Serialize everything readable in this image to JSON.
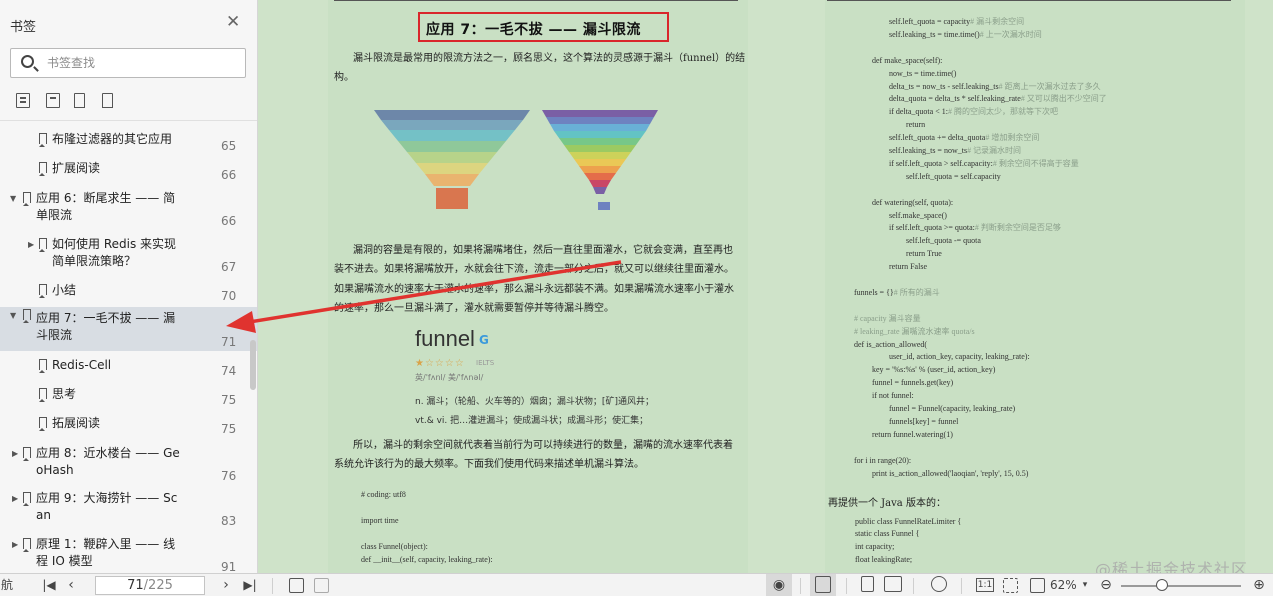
{
  "sidebar": {
    "title": "书签",
    "search_placeholder": "书签查找",
    "bookmarks": [
      {
        "label": "布隆过滤器的其它应用",
        "page": "65",
        "arrow": ""
      },
      {
        "label": "扩展阅读",
        "page": "66",
        "arrow": ""
      },
      {
        "label": "应用 6：断尾求生 —— 简单限流",
        "label1": "应用 6：断尾求生 —— 简",
        "label2": "单限流",
        "page": "66",
        "arrow": "▼"
      },
      {
        "label": "如何使用 Redis 来实现简单限流策略？",
        "label1": "如何使用 Redis 来实现",
        "label2": "简单限流策略？",
        "page": "67",
        "arrow": "▶"
      },
      {
        "label": "小结",
        "page": "70",
        "arrow": ""
      },
      {
        "label": "应用 7：一毛不拔 —— 漏斗限流",
        "label1": "应用 7：一毛不拔 —— 漏",
        "label2": "斗限流",
        "page": "71",
        "arrow": "▼"
      },
      {
        "label": "Redis-Cell",
        "page": "74",
        "arrow": ""
      },
      {
        "label": "思考",
        "page": "75",
        "arrow": ""
      },
      {
        "label": "拓展阅读",
        "page": "75",
        "arrow": ""
      },
      {
        "label": "应用 8：近水楼台 —— GeoHash",
        "label1": "应用 8：近水楼台 —— Ge",
        "label2": "oHash",
        "page": "76",
        "arrow": "▶"
      },
      {
        "label": "应用 9：大海捞针 —— Scan",
        "label1": "应用 9：大海捞针 —— Sc",
        "label2": "an",
        "page": "83",
        "arrow": "▶"
      },
      {
        "label": "原理 1：鞭辟入里 —— 线程 IO 模型",
        "label1": "原理 1：鞭辟入里 —— 线",
        "label2": "程 IO 模型",
        "page": "91",
        "arrow": "▶"
      }
    ]
  },
  "document": {
    "title": "应用 7：一毛不拔 —— 漏斗限流",
    "intro": "漏斗限流是最常用的限流方法之一，顾名思义，这个算法的灵感源于漏斗（funnel）的结构。",
    "intro1": "漏斗限流是最常用的限流方法之一，顾名思义，这个算法的灵感源于漏斗（funnel）的结",
    "intro2": "构。",
    "para2_lines": [
      "漏洞的容量是有限的，如果将漏嘴堵住，然后一直往里面灌水，它就会变满，直至再也",
      "装不进去。如果将漏嘴放开，水就会往下流，流走一部分之后，就又可以继续往里面灌水。",
      "如果漏嘴流水的速率大于灌水的速率，那么漏斗永远都装不满。如果漏嘴流水速率小于灌水",
      "的速率，那么一旦漏斗满了，灌水就需要暂停并等待漏斗腾空。"
    ],
    "dict": {
      "word": "funnel",
      "level": "IELTS",
      "phonetic": "英/'fʌnl/  美/'fʌnəl/",
      "def1": "n. 漏斗；（轮船、火车等的）烟囱；漏斗状物；[矿]通风井；",
      "def2": "vt.& vi. 把…灌进漏斗；使成漏斗状；成漏斗形；使汇集；"
    },
    "para3_lines": [
      "所以，漏斗的剩余空间就代表着当前行为可以持续进行的数量，漏嘴的流水速率代表着",
      "系统允许该行为的最大频率。下面我们使用代码来描述单机漏斗算法。"
    ],
    "code_left": [
      "# coding: utf8",
      "",
      "import time",
      "",
      "class Funnel(object):",
      "    def __init__(self, capacity, leaking_rate):"
    ],
    "code_right": [
      {
        "code": "        self.left_quota = capacity",
        "comment": "  # 漏斗剩余空间"
      },
      {
        "code": "        self.leaking_ts = time.time()",
        "comment": "  # 上一次漏水时间"
      },
      {
        "code": "",
        "comment": ""
      },
      {
        "code": "    def make_space(self):",
        "comment": ""
      },
      {
        "code": "        now_ts = time.time()",
        "comment": ""
      },
      {
        "code": "        delta_ts = now_ts - self.leaking_ts",
        "comment": "  # 距离上一次漏水过去了多久"
      },
      {
        "code": "        delta_quota = delta_ts * self.leaking_rate",
        "comment": "  # 又可以腾出不少空间了"
      },
      {
        "code": "        if delta_quota < 1:",
        "comment": "  # 腾的空间太少，那就等下次吧"
      },
      {
        "code": "            return",
        "comment": ""
      },
      {
        "code": "        self.left_quota += delta_quota",
        "comment": "  # 增加剩余空间"
      },
      {
        "code": "        self.leaking_ts = now_ts",
        "comment": "  # 记录漏水时间"
      },
      {
        "code": "        if self.left_quota > self.capacity:",
        "comment": "  # 剩余空间不得高于容量"
      },
      {
        "code": "            self.left_quota = self.capacity",
        "comment": ""
      },
      {
        "code": "",
        "comment": ""
      },
      {
        "code": "    def watering(self, quota):",
        "comment": ""
      },
      {
        "code": "        self.make_space()",
        "comment": ""
      },
      {
        "code": "        if self.left_quota >= quota:",
        "comment": "  # 判断剩余空间是否足够"
      },
      {
        "code": "            self.left_quota -= quota",
        "comment": ""
      },
      {
        "code": "            return True",
        "comment": ""
      },
      {
        "code": "        return False",
        "comment": ""
      },
      {
        "code": "",
        "comment": ""
      },
      {
        "code": "funnels = {}",
        "comment": "  # 所有的漏斗"
      },
      {
        "code": "",
        "comment": ""
      },
      {
        "code": "",
        "comment": "# capacity 漏斗容量"
      },
      {
        "code": "",
        "comment": "# leaking_rate 漏嘴流水速率 quota/s"
      },
      {
        "code": "def is_action_allowed(",
        "comment": ""
      },
      {
        "code": "        user_id, action_key, capacity, leaking_rate):",
        "comment": ""
      },
      {
        "code": "    key = '%s:%s' % (user_id, action_key)",
        "comment": ""
      },
      {
        "code": "    funnel = funnels.get(key)",
        "comment": ""
      },
      {
        "code": "    if not funnel:",
        "comment": ""
      },
      {
        "code": "        funnel = Funnel(capacity, leaking_rate)",
        "comment": ""
      },
      {
        "code": "        funnels[key] = funnel",
        "comment": ""
      },
      {
        "code": "    return funnel.watering(1)",
        "comment": ""
      },
      {
        "code": "",
        "comment": ""
      },
      {
        "code": "for i in range(20):",
        "comment": ""
      },
      {
        "code": "    print is_action_allowed('laoqian', 'reply', 15, 0.5)",
        "comment": ""
      }
    ],
    "java_intro": "再提供一个 Java 版本的：",
    "java_code": [
      "public class FunnelRateLimiter {",
      "    static class Funnel {",
      "        int capacity;",
      "        float leakingRate;"
    ]
  },
  "bottombar": {
    "nav_label": "航",
    "page_current": "71",
    "page_total": "/225",
    "zoom": "62%",
    "watermark": "@稀土掘金技术社区"
  },
  "colors": {
    "page_bg": "#c9e0c4",
    "title_border": "#d9262b",
    "arrow": "#e0332f",
    "selected_bookmark": "#d8dde3"
  }
}
